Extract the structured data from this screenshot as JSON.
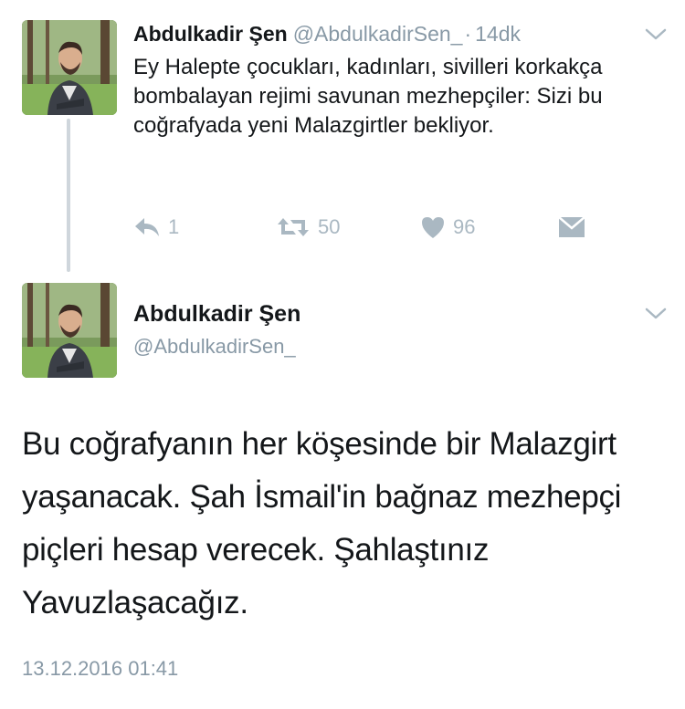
{
  "tweet1": {
    "author_name": "Abdulkadir Şen",
    "handle": "@AbdulkadirSen_",
    "separator": "·",
    "time": "14dk",
    "text": "Ey Halepte çocukları, kadınları, sivilleri korkakça bombalayan rejimi savunan mezhepçiler: Sizi bu coğrafyada yeni Malazgirtler bekliyor.",
    "reply_count": "1",
    "retweet_count": "50",
    "like_count": "96",
    "icons": [
      "reply-icon",
      "retweet-icon",
      "heart-icon",
      "message-icon",
      "chevron-down-icon"
    ]
  },
  "tweet2": {
    "author_name": "Abdulkadir Şen",
    "handle": "@AbdulkadirSen_",
    "text": "Bu coğrafyanın her köşesinde bir Malazgirt yaşanacak.  Şah İsmail'in bağnaz mezhepçi piçleri hesap verecek. Şahlaştınız Yavuzlaşacağız.",
    "date": "13.12.2016 01:41"
  },
  "colors": {
    "text": "#14171a",
    "secondary": "#8899a6",
    "icon": "#aab8c2",
    "thread_line": "#cfd6dc"
  }
}
